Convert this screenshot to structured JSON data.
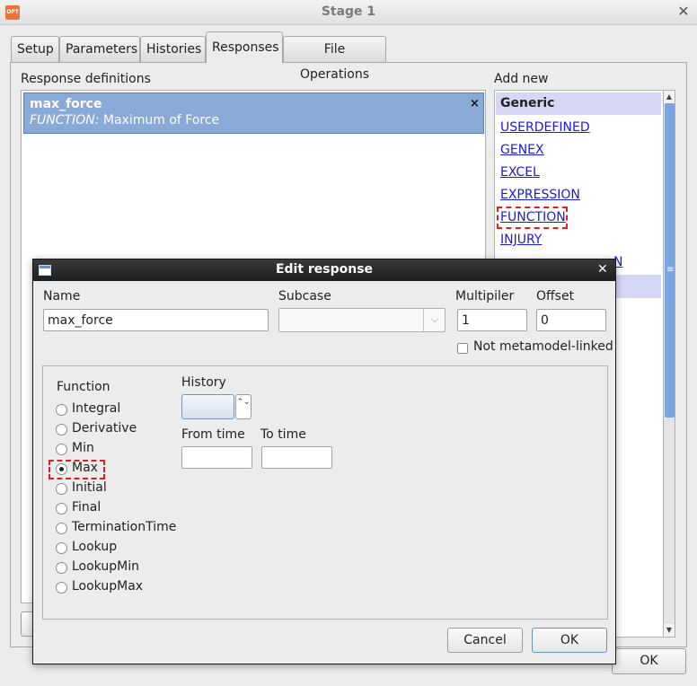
{
  "window": {
    "title": "Stage 1",
    "logo_text": "OPT",
    "close_glyph": "✕",
    "ok_label": "OK"
  },
  "tabs": [
    {
      "label": "Setup",
      "active": false
    },
    {
      "label": "Parameters",
      "active": false
    },
    {
      "label": "Histories",
      "active": false
    },
    {
      "label": "Responses",
      "active": true
    },
    {
      "label": "File Operations",
      "active": false
    }
  ],
  "responses": {
    "section_label": "Response definitions",
    "items": [
      {
        "name": "max_force",
        "type_keyword": "FUNCTION:",
        "description": "Maximum of Force",
        "delete_glyph": "×"
      }
    ]
  },
  "add_new": {
    "label": "Add new",
    "header": "Generic",
    "links": [
      "USERDEFINED",
      "GENEX",
      "EXCEL",
      "EXPRESSION",
      "FUNCTION",
      "INJURY"
    ],
    "highlighted_link": "FUNCTION",
    "partial_link_text": "N",
    "scroll_grip": "≡",
    "scroll_up": "▲",
    "scroll_down": "▼"
  },
  "dialog": {
    "title": "Edit response",
    "close_glyph": "✕",
    "name": {
      "label": "Name",
      "value": "max_force"
    },
    "subcase": {
      "label": "Subcase",
      "value": "",
      "arrow": "⌵"
    },
    "multiplier": {
      "label": "Multipiler",
      "value": "1"
    },
    "offset": {
      "label": "Offset",
      "value": "0"
    },
    "not_metamodel": {
      "label": "Not metamodel-linked",
      "checked": false
    },
    "function": {
      "label": "Function",
      "options": [
        "Integral",
        "Derivative",
        "Min",
        "Max",
        "Initial",
        "Final",
        "TerminationTime",
        "Lookup",
        "LookupMin",
        "LookupMax"
      ],
      "selected": "Max"
    },
    "history": {
      "label": "History",
      "value": "",
      "spinner": "⌃⌄"
    },
    "from_time": {
      "label": "From time",
      "value": ""
    },
    "to_time": {
      "label": "To time",
      "value": ""
    },
    "cancel_label": "Cancel",
    "ok_label": "OK"
  },
  "colors": {
    "selection": "#89a9d6",
    "link": "#1a1ae6",
    "header": "#d6d6f5",
    "highlight": "#e02020"
  }
}
